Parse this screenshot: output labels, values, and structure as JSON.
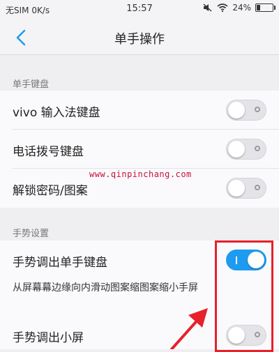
{
  "status": {
    "carrier": "无SIM 0K/s",
    "time": "15:57",
    "battery": "24%",
    "battery_level": 0.24
  },
  "navbar": {
    "title": "单手操作"
  },
  "sections": [
    {
      "header": "单手键盘",
      "items": [
        {
          "label": "vivo 输入法键盘",
          "on": false
        },
        {
          "label": "电话拨号键盘",
          "on": false
        },
        {
          "label": "解锁密码/图案",
          "on": false
        }
      ]
    },
    {
      "header": "手势设置",
      "items": [
        {
          "label": "手势调出单手键盘",
          "on": true
        },
        {
          "label": "手势调出小屏",
          "on": false
        }
      ],
      "description": "从屏幕幕边缘向内滑动图案缩图案缩小手屏"
    }
  ],
  "watermark": "www.qinpinchang.com",
  "colors": {
    "accent": "#1e9bf0",
    "highlight": "#e8202a",
    "watermark": "#c8103a"
  }
}
